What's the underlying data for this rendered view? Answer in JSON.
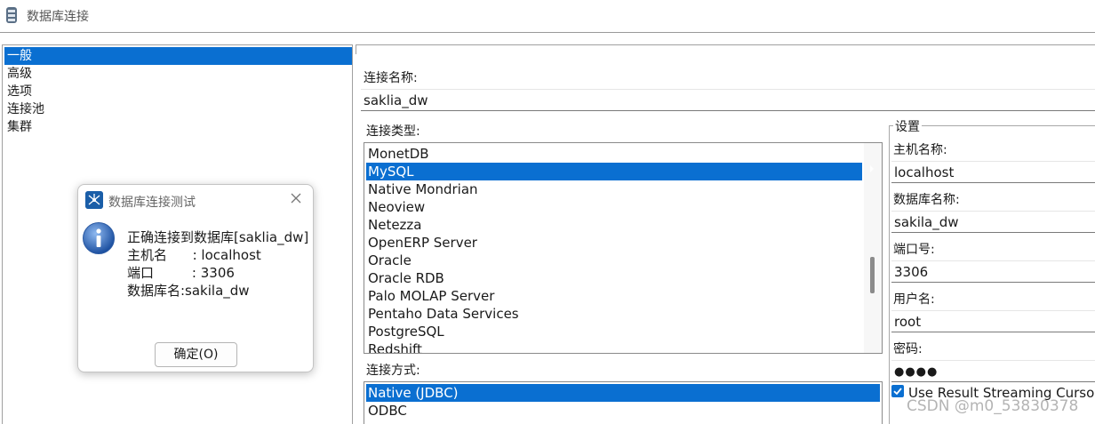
{
  "window": {
    "title": "数据库连接"
  },
  "nav": {
    "items": [
      "一般",
      "高级",
      "选项",
      "连接池",
      "集群"
    ],
    "selected_index": 0
  },
  "form": {
    "connection_name_label": "连接名称:",
    "connection_name_value": "saklia_dw",
    "connection_type_label": "连接类型:",
    "connection_types": [
      "MonetDB",
      "MySQL",
      "Native Mondrian",
      "Neoview",
      "Netezza",
      "OpenERP Server",
      "Oracle",
      "Oracle RDB",
      "Palo MOLAP Server",
      "Pentaho Data Services",
      "PostgreSQL",
      "Redshift"
    ],
    "selected_type_index": 1,
    "access_label": "连接方式:",
    "access_methods": [
      "Native (JDBC)",
      "ODBC"
    ],
    "selected_access_index": 0
  },
  "settings": {
    "title": "设置",
    "host_label": "主机名称:",
    "host_value": "localhost",
    "db_label": "数据库名称:",
    "db_value": "sakila_dw",
    "port_label": "端口号:",
    "port_value": "3306",
    "user_label": "用户名:",
    "user_value": "root",
    "password_label": "密码:",
    "password_value": "●●●●",
    "streaming_label": "Use Result Streaming Cursor",
    "streaming_checked": true
  },
  "dialog": {
    "title": "数据库连接测试",
    "line1": "正确连接到数据库[saklia_dw]",
    "line2": "主机名      : localhost",
    "line3": "端口         : 3306",
    "line4": "数据库名:sakila_dw",
    "ok_label": "确定(O)"
  },
  "watermark": "CSDN @m0_53830378",
  "colors": {
    "selection": "#0a6fd1",
    "dialog_icon": "#1a5ea8"
  }
}
